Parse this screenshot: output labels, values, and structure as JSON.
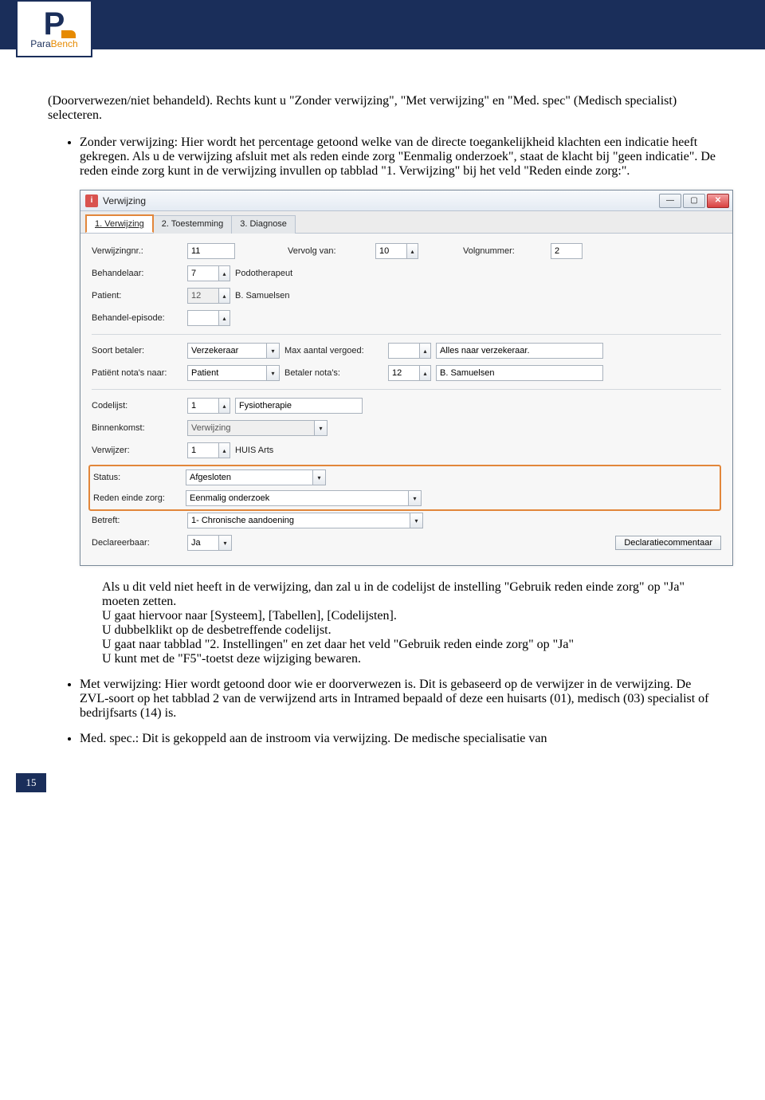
{
  "header": {
    "logo_line1": "P",
    "logo_para": "Para",
    "logo_bench": "Bench"
  },
  "intro": "(Doorverwezen/niet behandeld). Rechts kunt u \"Zonder verwijzing\", \"Met verwijzing\" en \"Med. spec\" (Medisch specialist) selecteren.",
  "bullet1": "Zonder verwijzing: Hier wordt het percentage getoond welke van de directe toegankelijkheid klachten een indicatie heeft gekregen. Als u de verwijzing afsluit met als reden einde zorg \"Eenmalig onderzoek\", staat de klacht bij \"geen indicatie\". De reden einde zorg kunt in de verwijzing invullen op tabblad \"1. Verwijzing\" bij het veld \"Reden einde zorg:\".",
  "window": {
    "title": "Verwijzing",
    "min": "—",
    "max": "▢",
    "close": "✕",
    "tabs": [
      "1. Verwijzing",
      "2. Toestemming",
      "3. Diagnose"
    ],
    "labels": {
      "verwijzingnr": "Verwijzingnr.:",
      "vervolg_van": "Vervolg van:",
      "volgnummer": "Volgnummer:",
      "behandelaar": "Behandelaar:",
      "patient": "Patient:",
      "behandel_episode": "Behandel-episode:",
      "soort_betaler": "Soort betaler:",
      "max_vergoed": "Max aantal vergoed:",
      "patient_nota": "Patiënt nota's naar:",
      "betaler_nota": "Betaler nota's:",
      "codelijst": "Codelijst:",
      "binnenkomst": "Binnenkomst:",
      "verwijzer": "Verwijzer:",
      "status": "Status:",
      "reden_einde": "Reden einde zorg:",
      "betreft": "Betreft:",
      "declareerbaar": "Declareerbaar:"
    },
    "values": {
      "verwijzingnr": "11",
      "vervolg_van": "10",
      "volgnummer": "2",
      "behandelaar": "7",
      "behandelaar_naam": "Podotherapeut",
      "patient": "12",
      "patient_naam": "B. Samuelsen",
      "soort_betaler": "Verzekeraar",
      "alles_verzekeraar": "Alles naar verzekeraar.",
      "patient_nota": "Patient",
      "betaler_nota_num": "12",
      "betaler_nota_naam": "B. Samuelsen",
      "codelijst": "1",
      "codelijst_naam": "Fysiotherapie",
      "binnenkomst": "Verwijzing",
      "verwijzer": "1",
      "verwijzer_naam": "HUIS Arts",
      "status": "Afgesloten",
      "reden_einde": "Eenmalig onderzoek",
      "betreft": "1- Chronische aandoening",
      "declareerbaar": "Ja"
    },
    "button_declaratie": "Declaratiecommentaar"
  },
  "after_screenshot": [
    "Als u dit veld niet heeft in de verwijzing, dan zal u in de codelijst de instelling \"Gebruik reden einde zorg\" op \"Ja\" moeten zetten.",
    "U gaat hiervoor naar [Systeem], [Tabellen], [Codelijsten].",
    "U dubbelklikt op de desbetreffende codelijst.",
    "U gaat naar tabblad \"2. Instellingen\" en zet daar het veld \"Gebruik reden einde zorg\" op \"Ja\"",
    "U kunt met de \"F5\"-toetst deze wijziging bewaren."
  ],
  "bullet2": "Met verwijzing: Hier wordt getoond door wie er doorverwezen is. Dit is gebaseerd op de verwijzer in de verwijzing. De ZVL-soort op het tabblad 2 van de verwijzend arts in Intramed bepaald of deze een huisarts (01), medisch (03) specialist of bedrijfsarts (14) is.",
  "bullet3": "Med. spec.: Dit is gekoppeld aan de instroom via verwijzing. De medische specialisatie van",
  "page_number": "15"
}
